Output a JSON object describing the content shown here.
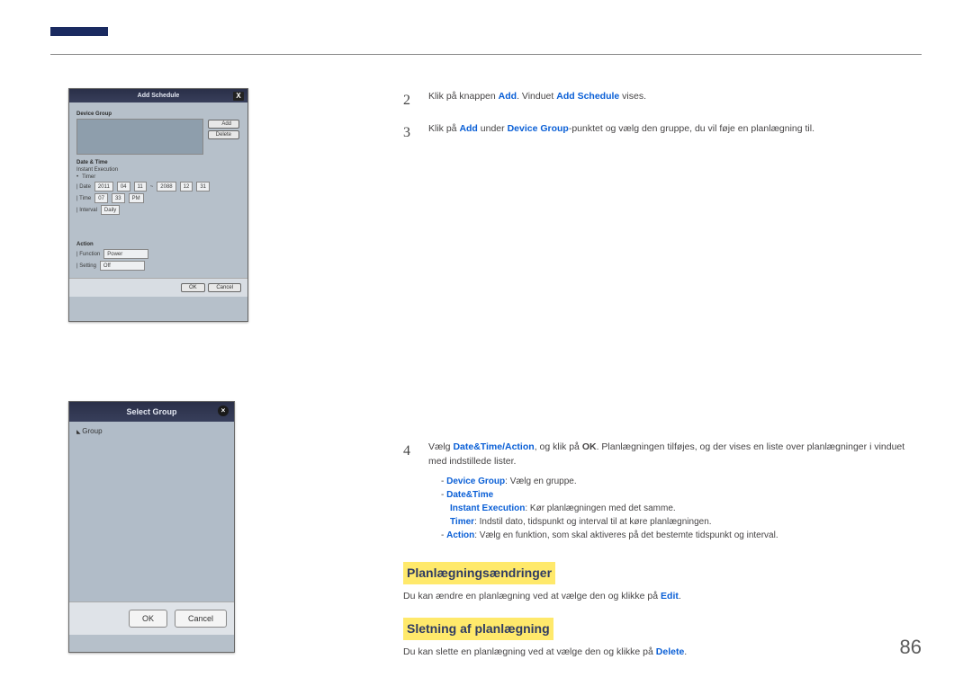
{
  "page_number": "86",
  "shot1": {
    "title": "Add Schedule",
    "device_group": "Device Group",
    "btn_add": "Add",
    "btn_delete": "Delete",
    "date_time": "Date & Time",
    "instant_exec": "Instant Execution",
    "timer": "Timer",
    "date_label": "Date",
    "date_y1": "2011",
    "date_m1": "04",
    "date_d1": "11",
    "date_y2": "2088",
    "date_m2": "12",
    "date_d2": "31",
    "time_label": "Time",
    "time_h": "07",
    "time_m": "33",
    "time_ap": "PM",
    "interval_label": "Interval",
    "interval_val": "Daily",
    "action": "Action",
    "function_label": "Function",
    "function_val": "Power",
    "setting_label": "Setting",
    "setting_val": "Off",
    "ok": "OK",
    "cancel": "Cancel"
  },
  "shot2": {
    "title": "Select Group",
    "group": "Group",
    "ok": "OK",
    "cancel": "Cancel"
  },
  "steps": {
    "n2": "2",
    "s2_a": "Klik på knappen ",
    "s2_add": "Add",
    "s2_b": ". Vinduet ",
    "s2_addsched": "Add Schedule",
    "s2_c": " vises.",
    "n3": "3",
    "s3_a": "Klik på ",
    "s3_add": "Add",
    "s3_b": " under ",
    "s3_dg": "Device Group",
    "s3_c": "-punktet og vælg den gruppe, du vil føje en planlægning til.",
    "n4": "4",
    "s4_a": "Vælg ",
    "s4_dta": "Date&Time/Action",
    "s4_b": ", og klik på ",
    "s4_ok": "OK",
    "s4_c": ". Planlægningen tilføjes, og der vises en liste over planlægninger i vinduet med indstillede lister.",
    "sub_dg_label": "Device Group",
    "sub_dg_text": ": Vælg en gruppe.",
    "sub_dt": "Date&Time",
    "sub_ie_label": "Instant Execution",
    "sub_ie_text": ": Kør planlægningen med det samme.",
    "sub_timer_label": "Timer",
    "sub_timer_text": ": Indstil dato, tidspunkt og interval til at køre planlægningen.",
    "sub_action_label": "Action",
    "sub_action_text": ": Vælg en funktion, som skal aktiveres på det bestemte tidspunkt og interval."
  },
  "head1": "Planlægningsændringer",
  "p1_a": "Du kan ændre en planlægning ved at vælge den og klikke på ",
  "p1_edit": "Edit",
  "head2": "Sletning af planlægning",
  "p2_a": "Du kan slette en planlægning ved at vælge den og klikke på ",
  "p2_delete": "Delete"
}
